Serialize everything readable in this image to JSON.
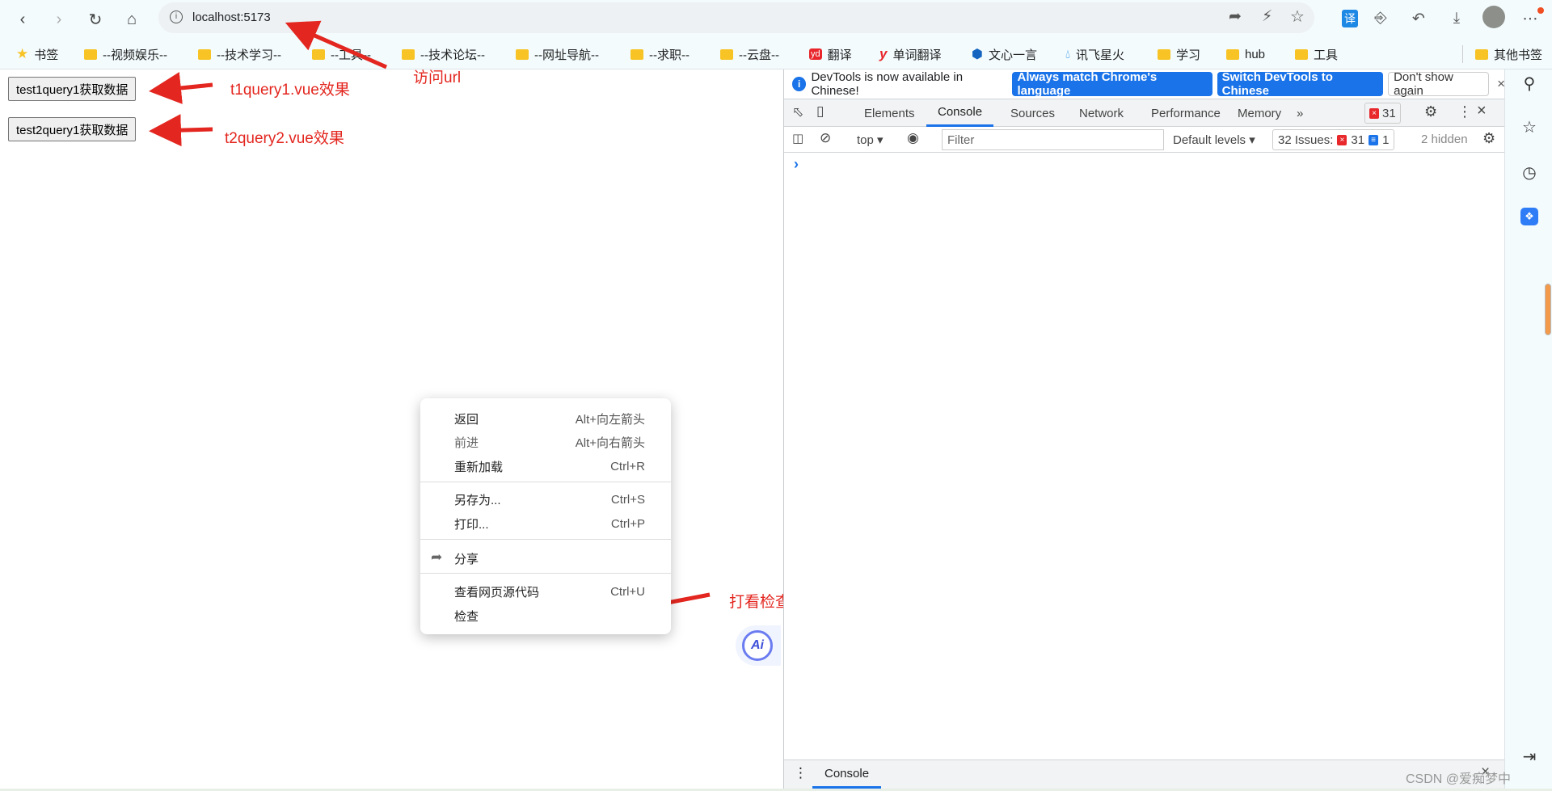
{
  "browser": {
    "url": "localhost:5173",
    "nav": {
      "back": "back",
      "forward": "forward",
      "reload": "reload",
      "home": "home"
    },
    "bookmarks": [
      {
        "label": "书签",
        "icon": "star-icon"
      },
      {
        "label": "--视频娱乐--",
        "icon": "folder-icon"
      },
      {
        "label": "--技术学习--",
        "icon": "folder-icon"
      },
      {
        "label": "--工具--",
        "icon": "folder-icon"
      },
      {
        "label": "--技术论坛--",
        "icon": "folder-icon"
      },
      {
        "label": "--网址导航--",
        "icon": "folder-icon"
      },
      {
        "label": "--求职--",
        "icon": "folder-icon"
      },
      {
        "label": "--云盘--",
        "icon": "folder-icon"
      },
      {
        "label": "翻译",
        "icon": "youdao-icon"
      },
      {
        "label": "单词翻译",
        "icon": "y-icon"
      },
      {
        "label": "文心一言",
        "icon": "wenxin-icon"
      },
      {
        "label": "讯飞星火",
        "icon": "xunfei-icon"
      },
      {
        "label": "学习",
        "icon": "folder-icon"
      },
      {
        "label": "hub",
        "icon": "folder-icon"
      },
      {
        "label": "工具",
        "icon": "folder-icon"
      }
    ],
    "other_bookmarks": "其他书签",
    "translate_ext": "译"
  },
  "page": {
    "button1": "test1query1获取数据",
    "button2": "test2query1获取数据"
  },
  "annotations": {
    "url": "访问url",
    "t1": "t1query1.vue效果",
    "t2": "t2query2.vue效果",
    "inspect": "打看检查注意观察跨域日志",
    "color": "#e3261f"
  },
  "context_menu": {
    "items": [
      {
        "label": "返回",
        "shortcut": "Alt+向左箭头"
      },
      {
        "label": "前进",
        "shortcut": "Alt+向右箭头"
      },
      {
        "label": "重新加载",
        "shortcut": "Ctrl+R"
      },
      {
        "label": "另存为...",
        "shortcut": "Ctrl+S"
      },
      {
        "label": "打印...",
        "shortcut": "Ctrl+P"
      },
      {
        "label": "分享",
        "shortcut": ""
      },
      {
        "label": "查看网页源代码",
        "shortcut": "Ctrl+U"
      },
      {
        "label": "检查",
        "shortcut": ""
      }
    ]
  },
  "ai_button": "Ai",
  "devtools": {
    "info_message": "DevTools is now available in Chinese!",
    "btn_match": "Always match Chrome's language",
    "btn_switch": "Switch DevTools to Chinese",
    "btn_dont_show": "Don't show again",
    "tabs": [
      "Elements",
      "Console",
      "Sources",
      "Network",
      "Performance",
      "Memory"
    ],
    "more_tabs": "»",
    "active_tab": "Console",
    "error_count": "31",
    "context": "top",
    "filter_placeholder": "Filter",
    "levels": "Default levels",
    "issues_label": "32 Issues:",
    "issues_errors": "31",
    "issues_info": "1",
    "hidden": "2 hidden",
    "prompt": "›",
    "drawer_tab": "Console",
    "accent": "#1a73e8"
  },
  "watermark": "CSDN @爱痴梦中"
}
